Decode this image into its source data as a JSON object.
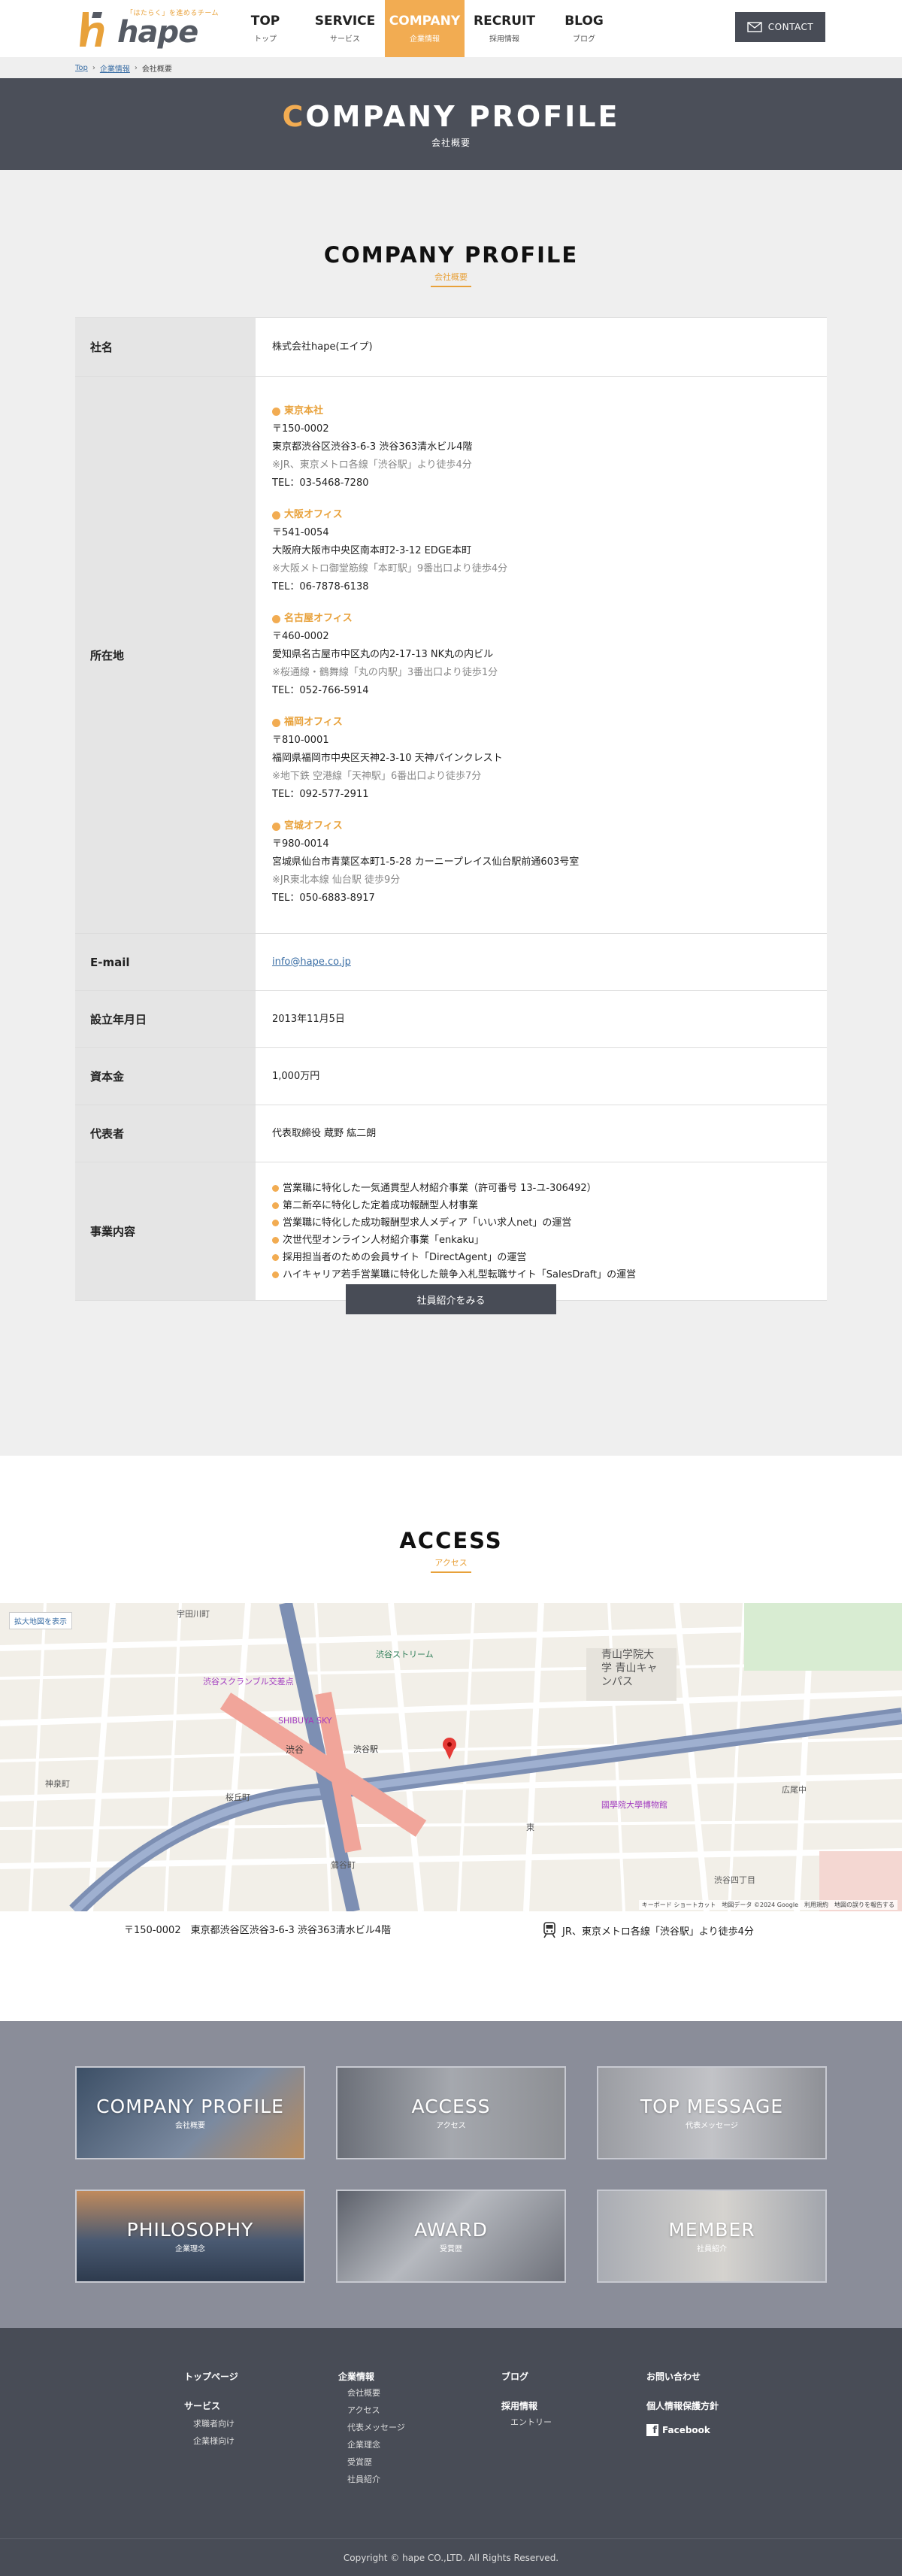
{
  "header": {
    "logo_tagline": "「はたらく」を進めるチーム",
    "logo_text": "hape",
    "nav": [
      {
        "en": "TOP",
        "ja": "トップ"
      },
      {
        "en": "SERVICE",
        "ja": "サービス"
      },
      {
        "en": "COMPANY",
        "ja": "企業情報"
      },
      {
        "en": "RECRUIT",
        "ja": "採用情報"
      },
      {
        "en": "BLOG",
        "ja": "ブログ"
      }
    ],
    "contact": "CONTACT"
  },
  "breadcrumb": [
    "Top",
    "企業情報",
    "会社概要"
  ],
  "hero": {
    "title_first": "C",
    "title_rest": "OMPANY PROFILE",
    "subtitle": "会社概要"
  },
  "profile": {
    "title": "COMPANY PROFILE",
    "subtitle": "会社概要",
    "company_label": "社名",
    "company_value": "株式会社hape(エイプ)",
    "address_label": "所在地",
    "offices": [
      {
        "name": "東京本社",
        "zip": "〒150-0002",
        "addr": "東京都渋谷区渋谷3-6-3 渋谷363清水ビル4階",
        "note": "※JR、東京メトロ各線「渋谷駅」より徒歩4分",
        "tel": "TEL：03-5468-7280"
      },
      {
        "name": "大阪オフィス",
        "zip": "〒541-0054",
        "addr": "大阪府大阪市中央区南本町2-3-12 EDGE本町",
        "note": "※大阪メトロ御堂筋線「本町駅」9番出口より徒歩4分",
        "tel": "TEL：06-7878-6138"
      },
      {
        "name": "名古屋オフィス",
        "zip": "〒460-0002",
        "addr": "愛知県名古屋市中区丸の内2-17-13 NK丸の内ビル",
        "note": "※桜通線・鶴舞線「丸の内駅」3番出口より徒歩1分",
        "tel": "TEL：052-766-5914"
      },
      {
        "name": "福岡オフィス",
        "zip": "〒810-0001",
        "addr": "福岡県福岡市中央区天神2-3-10 天神パインクレスト",
        "note": "※地下鉄 空港線「天神駅」6番出口より徒歩7分",
        "tel": "TEL：092-577-2911"
      },
      {
        "name": "宮城オフィス",
        "zip": "〒980-0014",
        "addr": "宮城県仙台市青葉区本町1-5-28 カーニープレイス仙台駅前通603号室",
        "note": "※JR東北本線 仙台駅 徒歩9分",
        "tel": "TEL：050-6883-8917"
      }
    ],
    "email_label": "E-mail",
    "email_value": "info@hape.co.jp",
    "founded_label": "設立年月日",
    "founded_value": "2013年11月5日",
    "capital_label": "資本金",
    "capital_value": "1,000万円",
    "rep_label": "代表者",
    "rep_value": "代表取締役 蔵野 紘二朗",
    "business_label": "事業内容",
    "business": [
      "営業職に特化した一気通貫型人材紹介事業（許可番号 13-ユ-306492）",
      "第二新卒に特化した定着成功報酬型人材事業",
      "営業職に特化した成功報酬型求人メディア「いい求人net」の運営",
      "次世代型オンライン人材紹介事業「enkaku」",
      "採用担当者のための会員サイト「DirectAgent」の運営",
      "ハイキャリア若手営業職に特化した競争入札型転職サイト「SalesDraft」の運営"
    ],
    "staff_button": "社員紹介をみる"
  },
  "access": {
    "title": "ACCESS",
    "subtitle": "アクセス",
    "map_link": "拡大地図を表示",
    "map_footer": "キーボード ショートカット　地図データ ©2024 Google　利用規約　地図の誤りを報告する",
    "map_labels": [
      "宇田川町",
      "渋谷スクランブル交差点",
      "SHIBUYA SKY",
      "渋谷",
      "渋谷駅",
      "渋谷ストリーム",
      "青山学院大学 青山キャンパス",
      "神泉町",
      "桜丘町",
      "鶯谷町",
      "東",
      "國學院大學博物館",
      "渋谷四丁目",
      "広尾中"
    ],
    "address": "〒150-0002　東京都渋谷区渋谷3-6-3 渋谷363清水ビル4階",
    "route": "JR、東京メトロ各線「渋谷駅」より徒歩4分"
  },
  "tiles": [
    {
      "en": "COMPANY PROFILE",
      "ja": "会社概要"
    },
    {
      "en": "ACCESS",
      "ja": "アクセス"
    },
    {
      "en": "TOP MESSAGE",
      "ja": "代表メッセージ"
    },
    {
      "en": "PHILOSOPHY",
      "ja": "企業理念"
    },
    {
      "en": "AWARD",
      "ja": "受賞歴"
    },
    {
      "en": "MEMBER",
      "ja": "社員紹介"
    }
  ],
  "footer": {
    "col1": {
      "h1": "トップページ",
      "h2": "サービス",
      "subs": [
        "求職者向け",
        "企業様向け"
      ]
    },
    "col2": {
      "h1": "企業情報",
      "subs": [
        "会社概要",
        "アクセス",
        "代表メッセージ",
        "企業理念",
        "受賞歴",
        "社員紹介"
      ]
    },
    "col3": {
      "h1": "ブログ",
      "h2": "採用情報",
      "subs": [
        "エントリー"
      ]
    },
    "col4": {
      "h1": "お問い合わせ",
      "h2": "個人情報保護方針",
      "h3": "Facebook"
    },
    "copyright": "Copyright © hape CO.,LTD. All Rights Reserved."
  }
}
